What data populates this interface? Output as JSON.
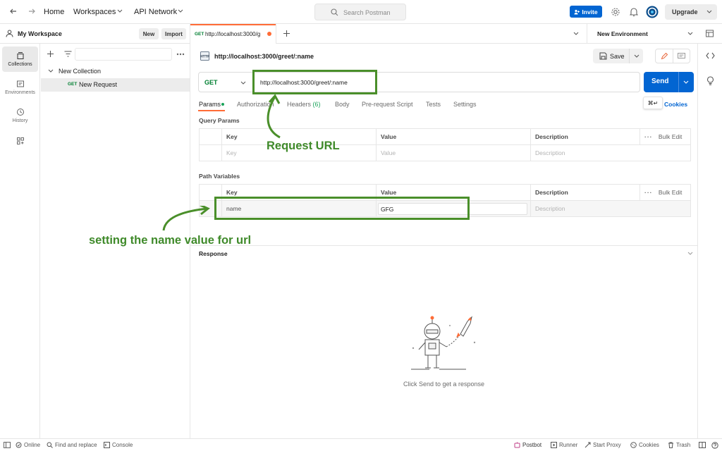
{
  "topbar": {
    "home": "Home",
    "workspaces": "Workspaces",
    "api_network": "API Network",
    "search_placeholder": "Search Postman",
    "invite": "Invite",
    "upgrade": "Upgrade"
  },
  "workspace": {
    "title": "My Workspace",
    "new_label": "New",
    "import_label": "Import"
  },
  "rail": {
    "items": [
      {
        "label": "Collections",
        "icon": "collections-icon",
        "active": true
      },
      {
        "label": "Environments",
        "icon": "environments-icon"
      },
      {
        "label": "History",
        "icon": "history-icon"
      },
      {
        "label": "",
        "icon": "apps-icon"
      }
    ]
  },
  "sidebar": {
    "collection": "New Collection",
    "request_method": "GET",
    "request_name": "New Request"
  },
  "tabs": {
    "tab1_method": "GET",
    "tab1_label": "http://localhost:3000/g",
    "environment": "New Environment"
  },
  "request": {
    "title": "http://localhost:3000/greet/:name",
    "save_label": "Save",
    "method": "GET",
    "url": "http://localhost:3000/greet/:name",
    "send_label": "Send",
    "shortcut_hint": "⌘↵",
    "cookies_label": "Cookies",
    "subtabs": {
      "params": "Params",
      "authorization": "Authorization",
      "headers": "Headers",
      "headers_count": "(6)",
      "body": "Body",
      "prerequest": "Pre-request Script",
      "tests": "Tests",
      "settings": "Settings"
    }
  },
  "query_params": {
    "title": "Query Params",
    "headers": [
      "Key",
      "Value",
      "Description"
    ],
    "bulk_edit": "Bulk Edit",
    "placeholder_key": "Key",
    "placeholder_value": "Value",
    "placeholder_description": "Description"
  },
  "path_variables": {
    "title": "Path Variables",
    "headers": [
      "Key",
      "Value",
      "Description"
    ],
    "bulk_edit": "Bulk Edit",
    "row_key": "name",
    "row_value": "GFG",
    "placeholder_description": "Description"
  },
  "response": {
    "title": "Response",
    "empty_message": "Click Send to get a response"
  },
  "annotations": {
    "request_url": "Request URL",
    "name_value": "setting the name value for url",
    "color": "#3f8a2a"
  },
  "statusbar": {
    "online": "Online",
    "find_replace": "Find and replace",
    "console": "Console",
    "postbot": "Postbot",
    "runner": "Runner",
    "start_proxy": "Start Proxy",
    "cookies": "Cookies",
    "trash": "Trash"
  },
  "colors": {
    "accent": "#ff6c37",
    "primary": "#0265d2",
    "get_method": "#007f31"
  }
}
